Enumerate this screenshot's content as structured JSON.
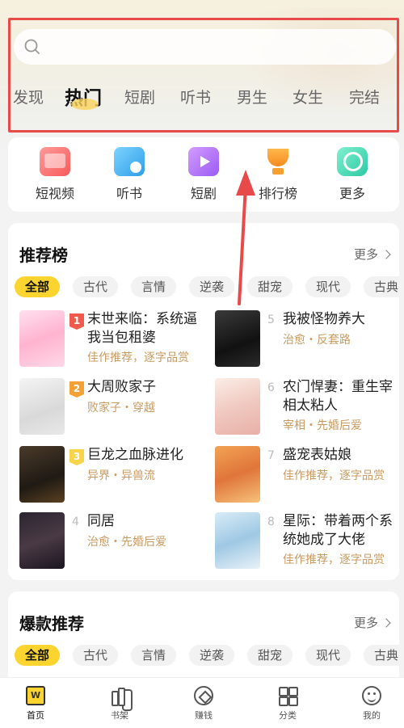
{
  "search": {
    "placeholder": "",
    "value": ""
  },
  "tabs": [
    {
      "label": "发现"
    },
    {
      "label": "热门",
      "active": true
    },
    {
      "label": "短剧"
    },
    {
      "label": "听书"
    },
    {
      "label": "男生"
    },
    {
      "label": "女生"
    },
    {
      "label": "完结"
    }
  ],
  "quick": [
    {
      "label": "短视频",
      "icon": "short-video-icon"
    },
    {
      "label": "听书",
      "icon": "audiobook-icon"
    },
    {
      "label": "短剧",
      "icon": "short-drama-icon"
    },
    {
      "label": "排行榜",
      "icon": "trophy-icon"
    },
    {
      "label": "更多",
      "icon": "more-icon"
    }
  ],
  "recommend": {
    "title": "推荐榜",
    "more": "更多",
    "chips": [
      "全部",
      "古代",
      "言情",
      "逆袭",
      "甜宠",
      "现代",
      "古典"
    ],
    "books": [
      {
        "rank": "1",
        "title": "末世来临：系统逼我当包租婆",
        "tags": "佳作推荐，逐字品赏"
      },
      {
        "rank": "2",
        "title": "大周败家子",
        "tags": "败家子・穿越"
      },
      {
        "rank": "3",
        "title": "巨龙之血脉进化",
        "tags": "异界・异兽流"
      },
      {
        "rank": "4",
        "title": "同居",
        "tags": "治愈・先婚后爱"
      },
      {
        "rank": "5",
        "title": "我被怪物养大",
        "tags": "治愈・反套路"
      },
      {
        "rank": "6",
        "title": "农门悍妻：重生宰相太粘人",
        "tags": "宰相・先婚后爱"
      },
      {
        "rank": "7",
        "title": "盛宠表姑娘",
        "tags": "佳作推荐，逐字品赏"
      },
      {
        "rank": "8",
        "title": "星际：带着两个系统她成了大佬",
        "tags": "佳作推荐，逐字品赏"
      }
    ]
  },
  "hot": {
    "title": "爆款推荐",
    "more": "更多",
    "chips": [
      "全部",
      "古代",
      "言情",
      "逆袭",
      "甜宠",
      "现代",
      "古典"
    ]
  },
  "nav": [
    {
      "label": "首页",
      "active": true
    },
    {
      "label": "书架"
    },
    {
      "label": "赚钱"
    },
    {
      "label": "分类"
    },
    {
      "label": "我的"
    }
  ],
  "colors": {
    "accent": "#fbd42f",
    "annotation": "#e84a4a",
    "tag": "#c99a5f"
  }
}
